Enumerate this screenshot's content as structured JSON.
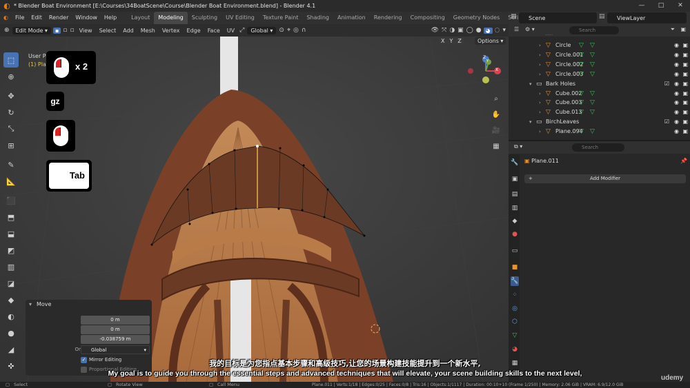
{
  "window": {
    "title": "* Blender Boat Environment [E:\\Courses\\34BoatScene\\Course\\Blender Boat Environment.blend] - Blender 4.1",
    "controls": [
      "minimize-icon",
      "maximize-icon",
      "close-icon"
    ]
  },
  "menu": {
    "items": [
      "File",
      "Edit",
      "Render",
      "Window",
      "Help"
    ],
    "workspaces": [
      "Layout",
      "Modeling",
      "Sculpting",
      "UV Editing",
      "Texture Paint",
      "Shading",
      "Animation",
      "Rendering",
      "Compositing",
      "Geometry Nodes",
      "Scripting"
    ],
    "active_workspace": "Modeling",
    "scene": "Scene",
    "view_layer": "ViewLayer"
  },
  "viewport_header": {
    "mode": "Edit Mode",
    "menus": [
      "View",
      "Select",
      "Add",
      "Mesh",
      "Vertex",
      "Edge",
      "Face",
      "UV"
    ],
    "orientation": "Global",
    "axes": [
      "X",
      "Y",
      "Z"
    ],
    "options": "Options"
  },
  "viewport": {
    "view_name": "User Pe",
    "object_line": "(1) Plan",
    "gizmo_axes": [
      "Z",
      "Y",
      "X"
    ]
  },
  "key_overlay": {
    "click_count": "x 2",
    "typed_keys": "gz",
    "key": "Tab"
  },
  "move_panel": {
    "title": "Move",
    "move_x_label": "Move X",
    "move_x": "0 m",
    "y_label": "Y",
    "y": "0 m",
    "z_label": "Z",
    "z": "-0.038759 m",
    "orientation_label": "Orientation",
    "orientation": "Global",
    "mirror_editing": "Mirror Editing",
    "proportional": "Proportional Editing"
  },
  "outliner": {
    "search_placeholder": "Search",
    "rows": [
      {
        "name": "Circle",
        "level": 2,
        "type": "object"
      },
      {
        "name": "Circle.001",
        "level": 2,
        "type": "object"
      },
      {
        "name": "Circle.002",
        "level": 2,
        "type": "object"
      },
      {
        "name": "Circle.003",
        "level": 2,
        "type": "object"
      },
      {
        "name": "Bark Holes",
        "level": 1,
        "type": "collection"
      },
      {
        "name": "Cube.002",
        "level": 2,
        "type": "object"
      },
      {
        "name": "Cube.003",
        "level": 2,
        "type": "object"
      },
      {
        "name": "Cube.013",
        "level": 2,
        "type": "object"
      },
      {
        "name": "BirchLeaves",
        "level": 1,
        "type": "collection"
      },
      {
        "name": "Plane.094",
        "level": 2,
        "type": "object"
      }
    ]
  },
  "properties": {
    "search_placeholder": "Search",
    "object_name": "Plane.011",
    "add_modifier": "Add Modifier"
  },
  "status_bar": {
    "left": [
      "Select",
      "Rotate View",
      "Call Menu"
    ],
    "stats": "Plane.011 | Verts:1/18 | Edges:0/25 | Faces:0/8 | Tris:16 | Objects:1/1117 | Duration: 00:10+10 (Frame 1/250) | Memory: 2.06 GiB | VRAM: 6.9/12.0 GiB"
  },
  "subtitles": {
    "zh": "我的目标是为您指点基本步骤和高级技巧,让您的场景构建技能提升到一个新水平,",
    "en": "My goal is to guide you through the essential steps and advanced techniques that will elevate, your scene building skills to the next level,"
  },
  "watermark": "Udemy",
  "colors": {
    "accent_blue": "#4772b3",
    "blender_orange": "#e87d0d",
    "modifier_green": "#3fbf5f",
    "selected_face": "#6b3a24"
  }
}
